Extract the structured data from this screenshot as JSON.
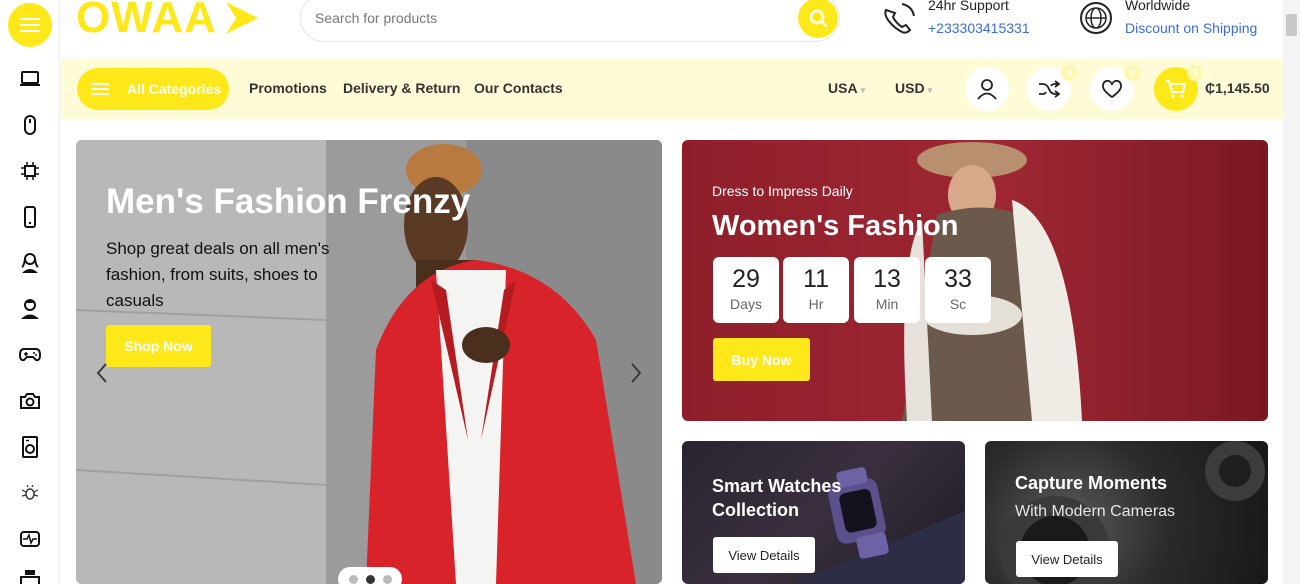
{
  "brand": {
    "logo_text": "OWAA",
    "accent": "#ffe81a",
    "link_color": "#3b6fd8"
  },
  "sidebar": {
    "items": [
      {
        "icon": "laptop-icon"
      },
      {
        "icon": "mouse-icon"
      },
      {
        "icon": "chip-icon"
      },
      {
        "icon": "smartphone-icon"
      },
      {
        "icon": "woman-user-icon"
      },
      {
        "icon": "man-user-icon"
      },
      {
        "icon": "gamepad-icon"
      },
      {
        "icon": "camera-icon"
      },
      {
        "icon": "washing-machine-icon"
      },
      {
        "icon": "bug-icon"
      },
      {
        "icon": "heart-monitor-icon"
      },
      {
        "icon": "printer-icon"
      }
    ]
  },
  "search": {
    "placeholder": "Search for products"
  },
  "support": {
    "title": "24hr Support",
    "phone": "+233303415331"
  },
  "shipping": {
    "title": "Worldwide",
    "subtitle": "Discount on Shipping"
  },
  "nav": {
    "categories_label": "All Categories",
    "links": [
      "Promotions",
      "Delivery & Return",
      "Our Contacts"
    ],
    "country": "USA",
    "currency": "USD",
    "compare_count": "0",
    "wishlist_count": "2",
    "cart_count": "1",
    "cart_total": "₵1,145.50"
  },
  "hero": {
    "title": "Men's Fashion Frenzy",
    "description": "Shop great deals on all men's fashion, from suits, shoes to casuals",
    "button": "Shop Now",
    "active_slide": 2,
    "slide_count": 3
  },
  "women_banner": {
    "subtitle": "Dress to Impress Daily",
    "title": "Women's Fashion",
    "countdown": [
      {
        "value": "29",
        "unit": "Days"
      },
      {
        "value": "11",
        "unit": "Hr"
      },
      {
        "value": "13",
        "unit": "Min"
      },
      {
        "value": "33",
        "unit": "Sc"
      }
    ],
    "button": "Buy Now"
  },
  "watch_banner": {
    "title_line1": "Smart Watches",
    "title_line2": "Collection",
    "button": "View Details"
  },
  "camera_banner": {
    "title": "Capture Moments",
    "subtitle": "With Modern Cameras",
    "button": "View Details"
  }
}
